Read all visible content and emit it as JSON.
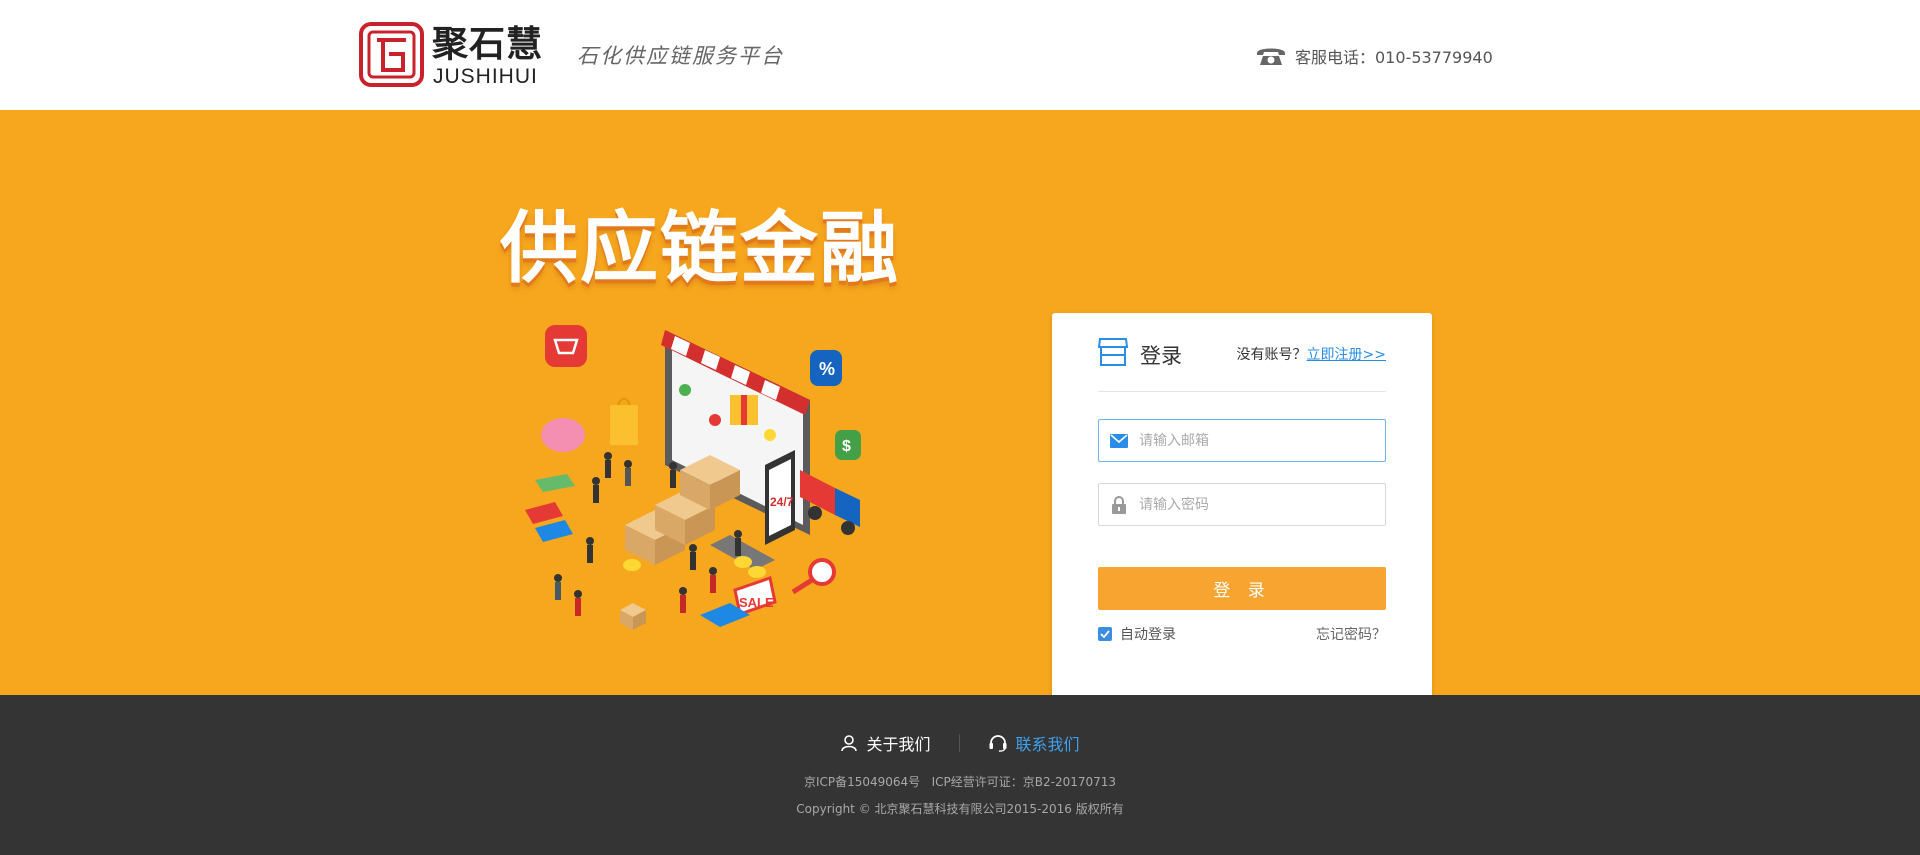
{
  "header": {
    "logo_cn": "聚石慧",
    "logo_en": "JUSHIHUI",
    "slogan": "石化供应链服务平台",
    "hotline_label": "客服电话：010-53779940",
    "icon": "phone-icon"
  },
  "banner": {
    "title": "供应链金融",
    "illustration_icon": "supply-chain-illustration",
    "background_color": "#f7a71e",
    "illustration_text": {
      "tag_24_7": "24/7",
      "sale": "SALE",
      "percent": "%",
      "dollar": "$"
    }
  },
  "login": {
    "title": "登录",
    "no_account_text": "没有账号？",
    "register_link": "立即注册>>",
    "email_placeholder": "请输入邮箱",
    "password_placeholder": "请输入密码",
    "submit_label": "登 录",
    "auto_login_label": "自动登录",
    "auto_login_checked": true,
    "forgot_label": "忘记密码？",
    "accent_color": "#f7a431",
    "link_color": "#2a8de8"
  },
  "footer": {
    "about_label": "关于我们",
    "contact_label": "联系我们",
    "icp_line": "京ICP备15049064号   ICP经营许可证：京B2-20170713",
    "copyright_line": "Copyright © 北京聚石慧科技有限公司2015-2016 版权所有",
    "background_color": "#343434"
  }
}
